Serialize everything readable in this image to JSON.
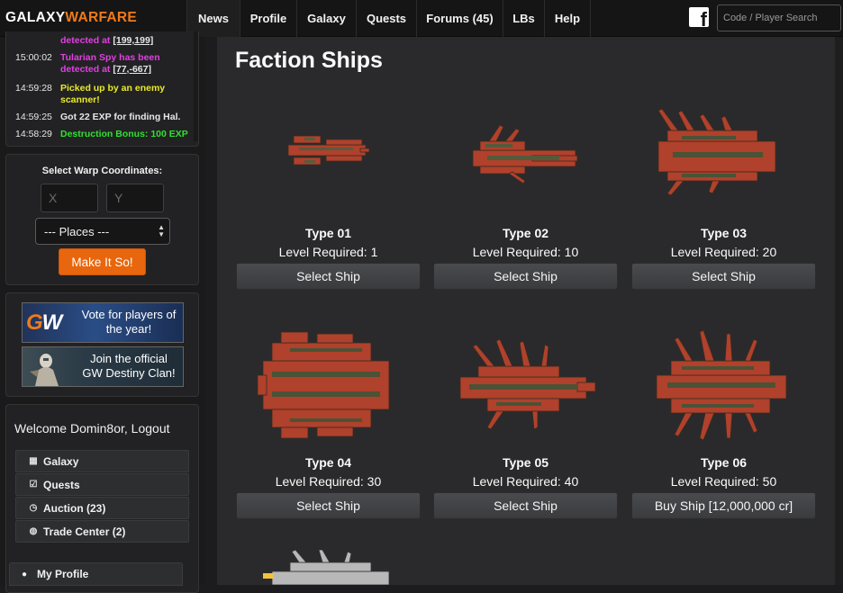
{
  "brand": {
    "part1": "GALAXY",
    "part2": "WARFARE"
  },
  "nav": [
    {
      "label": "News"
    },
    {
      "label": "Profile"
    },
    {
      "label": "Galaxy"
    },
    {
      "label": "Quests"
    },
    {
      "label": "Forums (45)"
    },
    {
      "label": "LBs"
    },
    {
      "label": "Help"
    }
  ],
  "facebook": {
    "glyph": "f",
    "icon": "facebook-icon"
  },
  "search": {
    "placeholder": "Code / Player Search"
  },
  "log": [
    {
      "time": "",
      "pre": "detected at ",
      "link": "[199,199]",
      "color": "pink"
    },
    {
      "time": "15:00:02",
      "pre": "Tularian Spy has been detected at ",
      "link": "[77,-667]",
      "color": "pink"
    },
    {
      "time": "14:59:28",
      "pre": "Picked up by an enemy scanner!",
      "link": "",
      "color": "yellow"
    },
    {
      "time": "14:59:25",
      "pre": "Got 22 EXP for finding Hal.",
      "link": "",
      "color": "white"
    },
    {
      "time": "14:58:29",
      "pre": "Destruction Bonus: 100 EXP",
      "link": "",
      "color": "green"
    }
  ],
  "warp": {
    "label": "Select Warp Coordinates:",
    "x_placeholder": "X",
    "y_placeholder": "Y",
    "places": "--- Places ---",
    "button": "Make It So!"
  },
  "banners": [
    {
      "text": "Vote for players of the year!",
      "logo_a": "G",
      "logo_b": "W"
    },
    {
      "text": "Join the official GW Destiny Clan!"
    }
  ],
  "welcome": "Welcome Domin8or, Logout",
  "menu": [
    {
      "label": "Galaxy",
      "icon": "grid-icon",
      "glyph": "▦"
    },
    {
      "label": "Quests",
      "icon": "checkbox-icon",
      "glyph": "☑"
    },
    {
      "label": "Auction (23)",
      "icon": "clock-icon",
      "glyph": "◷"
    },
    {
      "label": "Trade Center (2)",
      "icon": "globe-icon",
      "glyph": "◍"
    }
  ],
  "profile": {
    "label": "My Profile",
    "icon": "user-icon",
    "glyph": "👤"
  },
  "page": {
    "title": "Faction Ships"
  },
  "ships": [
    {
      "name": "Type 01",
      "level": "Level Required: 1",
      "button": "Select Ship"
    },
    {
      "name": "Type 02",
      "level": "Level Required: 10",
      "button": "Select Ship"
    },
    {
      "name": "Type 03",
      "level": "Level Required: 20",
      "button": "Select Ship"
    },
    {
      "name": "Type 04",
      "level": "Level Required: 30",
      "button": "Select Ship"
    },
    {
      "name": "Type 05",
      "level": "Level Required: 40",
      "button": "Select Ship"
    },
    {
      "name": "Type 06",
      "level": "Level Required: 50",
      "button": "Buy Ship [12,000,000 cr]"
    }
  ],
  "colors": {
    "accent": "#f07a1a",
    "button_orange": "#e8660d",
    "log_pink": "#e040e0",
    "log_yellow": "#eaea2a",
    "log_green": "#30e030"
  }
}
